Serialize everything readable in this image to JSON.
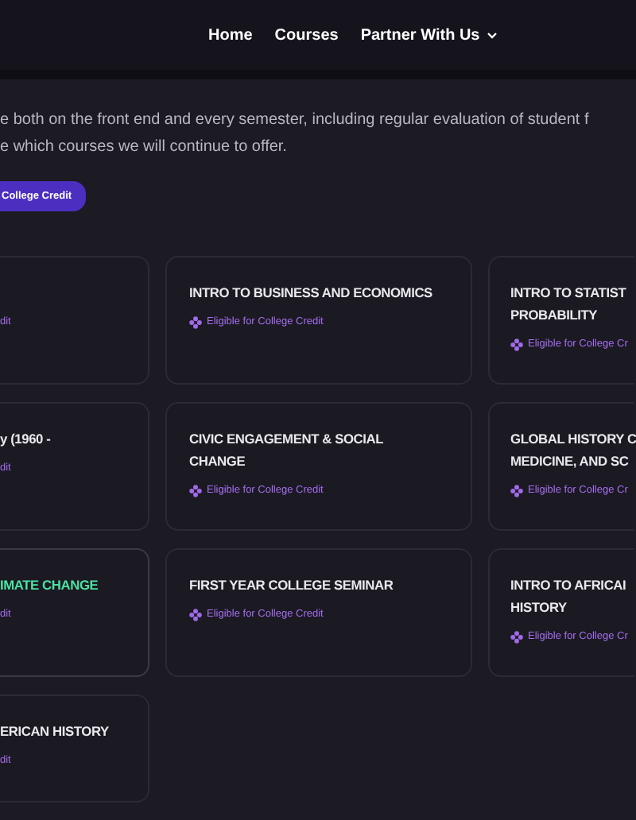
{
  "nav": [
    {
      "label": "Home",
      "kind": "link"
    },
    {
      "label": "Courses",
      "kind": "link"
    },
    {
      "label": "Partner With Us",
      "kind": "dropdown"
    }
  ],
  "intro": [
    "e both on the front end and every semester, including regular evaluation of student f",
    "e which courses we will continue to offer."
  ],
  "credit_button": "College Credit",
  "courses": [
    {
      "credit": "dit",
      "highlighted": false
    },
    {
      "title_lines": [
        "INTRO TO BUSINESS AND ECONOMICS"
      ],
      "credit": "Eligible for College Credit",
      "highlighted": false
    },
    {
      "title_lines": [
        "INTRO TO STATIST",
        "PROBABILITY"
      ],
      "credit": "Eligible for College Cr",
      "highlighted": false
    },
    {
      "title_lines": [
        "y (1960 -"
      ],
      "credit": "dit",
      "highlighted": false
    },
    {
      "title_lines": [
        "CIVIC ENGAGEMENT & SOCIAL",
        "CHANGE"
      ],
      "credit": "Eligible for College Credit",
      "highlighted": false
    },
    {
      "title_lines": [
        "GLOBAL HISTORY C",
        "MEDICINE, AND SC"
      ],
      "credit": "Eligible for College Cr",
      "highlighted": false
    },
    {
      "title_lines": [
        "IMATE CHANGE"
      ],
      "credit": "dit",
      "highlighted": true
    },
    {
      "title_lines": [
        "FIRST YEAR COLLEGE SEMINAR"
      ],
      "credit": "Eligible for College Credit",
      "highlighted": false
    },
    {
      "title_lines": [
        "INTRO TO AFRICAI",
        "HISTORY"
      ],
      "credit": "Eligible for College Cr",
      "highlighted": false
    },
    {
      "title_lines": [
        "ERICAN HISTORY"
      ],
      "credit": "dit",
      "highlighted": false
    }
  ]
}
